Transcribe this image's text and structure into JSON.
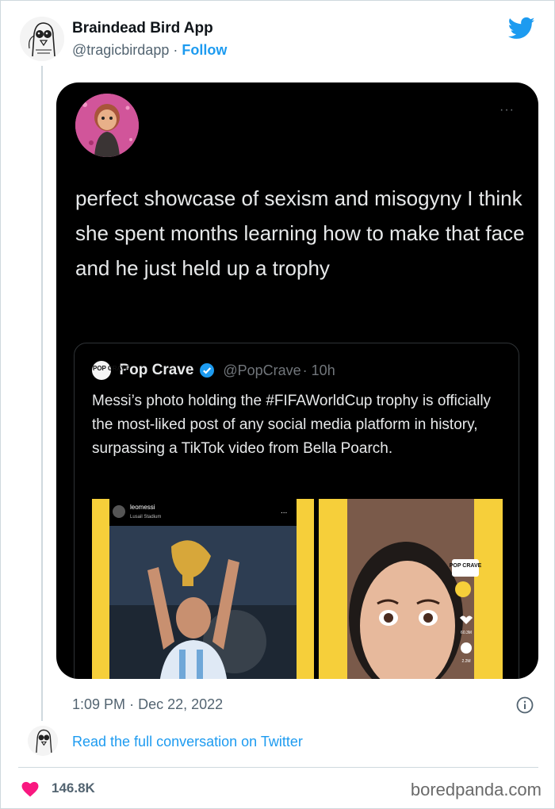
{
  "author": {
    "name": "Braindead Bird App",
    "handle": "@tragicbirdapp",
    "separator": "·",
    "follow_label": "Follow"
  },
  "embedded_tweet": {
    "more_label": "···",
    "text": "perfect showcase of sexism and misogyny I think she spent months learning how to make that face and he just held up a trophy",
    "quoted": {
      "logo_text": "POP CRAVE",
      "name": "Pop Crave",
      "handle": "@PopCrave",
      "time": "· 10h",
      "text": "Messi’s photo holding the #FIFAWorldCup trophy is officially the most-liked post of any social media platform in history, surpassing a TikTok video from Bella Poarch.",
      "left_image": {
        "username": "leomessi",
        "location": "Lusail Stadium",
        "more": "..."
      },
      "right_image": {
        "badge": "POP CRAVE",
        "stats": [
          "60.3M",
          "2.2M"
        ]
      }
    }
  },
  "meta": {
    "time": "1:09 PM",
    "separator": "·",
    "date": "Dec 22, 2022"
  },
  "read_full_label": "Read the full conversation on Twitter",
  "likes": "146.8K",
  "watermark": "boredpanda.com",
  "colors": {
    "twitter_blue": "#1d9bf0",
    "heart_red": "#f91880",
    "secondary_text": "#536471",
    "embedded_bg": "#000000"
  }
}
